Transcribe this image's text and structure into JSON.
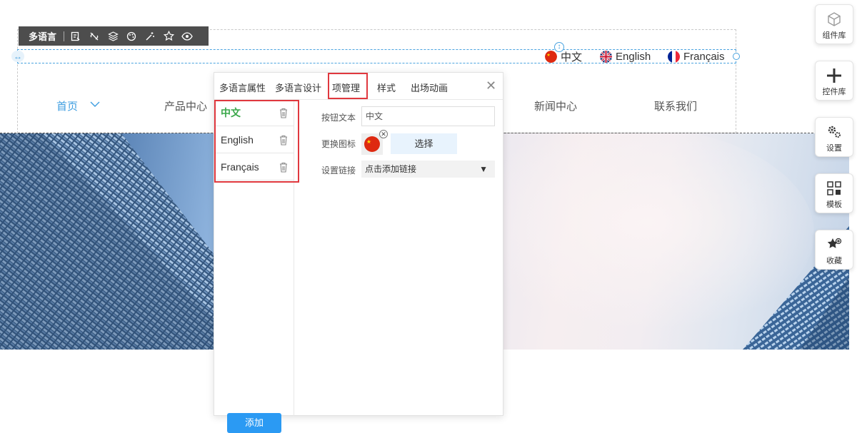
{
  "toolbar": {
    "title": "多语言",
    "icons": [
      "edit-icon",
      "link-off-icon",
      "layers-icon",
      "palette-icon",
      "magic-wand-icon",
      "star-icon",
      "eye-icon"
    ]
  },
  "language_switcher": [
    {
      "label": "中文",
      "flag": "china-flag-icon"
    },
    {
      "label": "English",
      "flag": "uk-flag-icon"
    },
    {
      "label": "Français",
      "flag": "france-flag-icon"
    }
  ],
  "nav": {
    "items": [
      "首页",
      "产品中心",
      "新闻中心",
      "联系我们"
    ]
  },
  "panel": {
    "tabs": [
      "多语言属性",
      "多语言设计",
      "项管理",
      "样式",
      "出场动画"
    ],
    "active_tab": "项管理",
    "items": [
      "中文",
      "English",
      "Français"
    ],
    "active_item": "中文",
    "add_label": "添加",
    "form": {
      "button_text_label": "按钮文本",
      "button_text_value": "中文",
      "icon_label": "更换图标",
      "choose_label": "选择",
      "link_label": "设置链接",
      "link_value": "点击添加链接"
    }
  },
  "side_tools": [
    {
      "label": "组件库",
      "icon": "cube-icon"
    },
    {
      "label": "控件库",
      "icon": "plus-icon"
    },
    {
      "label": "设置",
      "icon": "gears-icon"
    },
    {
      "label": "模板",
      "icon": "grid-icon"
    },
    {
      "label": "收藏",
      "icon": "star-add-icon"
    }
  ],
  "colors": {
    "accent": "#3d9de0",
    "highlight": "#e0383e",
    "active_item": "#3aa74a",
    "add_button": "#2b9af3"
  }
}
